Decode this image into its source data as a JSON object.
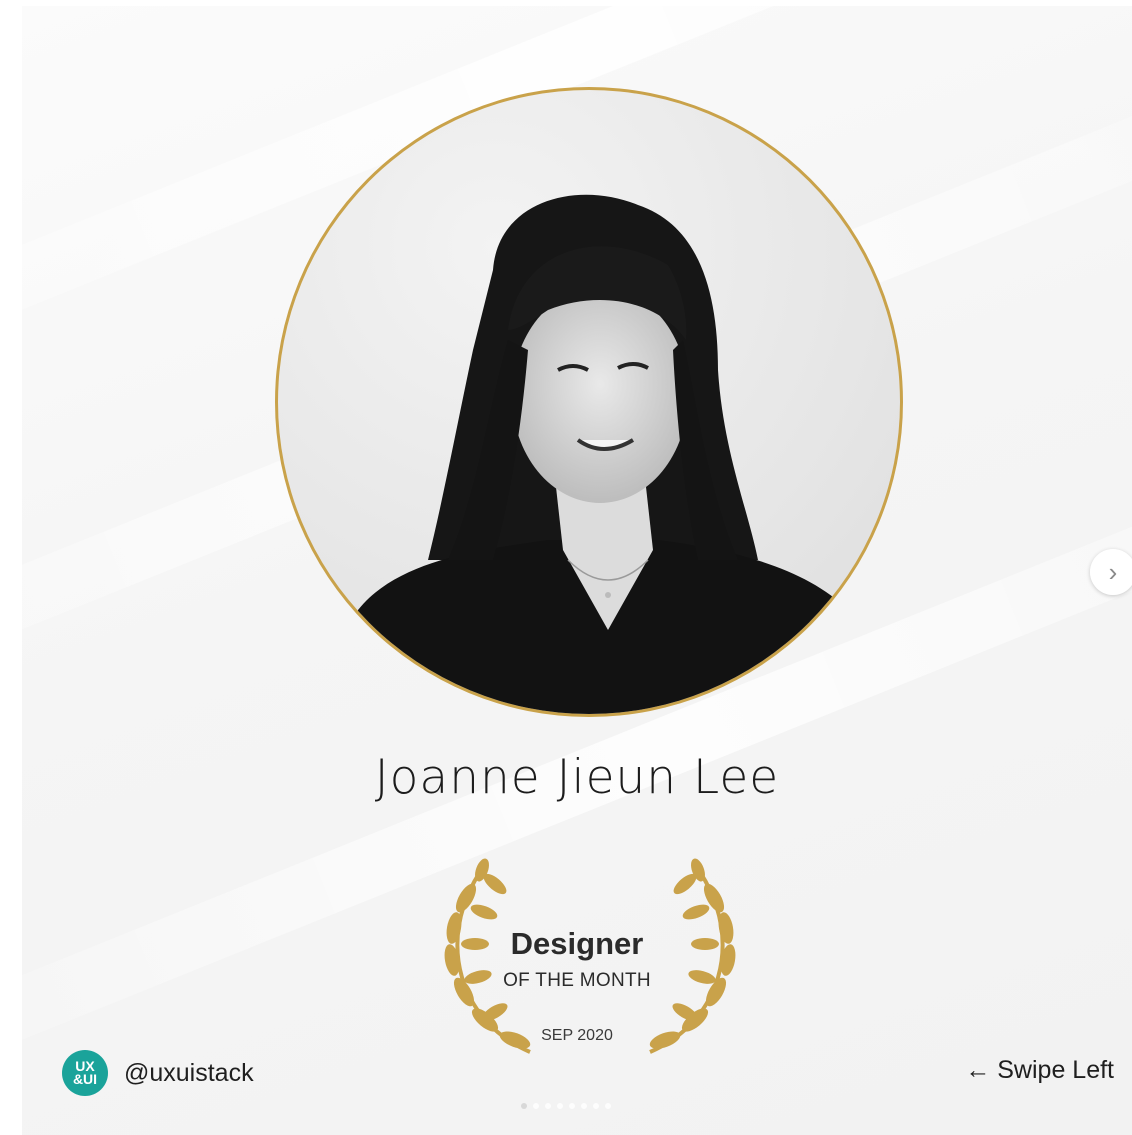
{
  "post": {
    "designer_name": "Joanne Jieun Lee",
    "badge": {
      "title": "Designer",
      "subtitle": "OF THE MONTH",
      "date": "SEP 2020"
    },
    "account": {
      "logo_text_top": "UX",
      "logo_text_bottom": "&UI",
      "handle": "@uxuistack"
    },
    "swipe_label": "← Swipe Left"
  },
  "carousel": {
    "next_icon": "chevron-right-icon",
    "dot_count": 8,
    "active_dot": 1
  },
  "colors": {
    "gold": "#c9a24a",
    "logo_teal": "#1aa39a",
    "text": "#1c1c1c"
  }
}
